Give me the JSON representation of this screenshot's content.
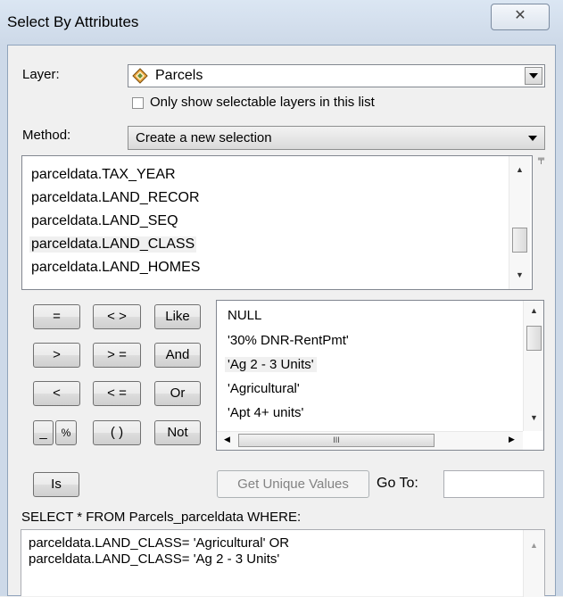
{
  "window": {
    "title": "Select By Attributes",
    "close_glyph": "✕"
  },
  "layer": {
    "label": "Layer:",
    "value": "Parcels",
    "icon": "layer-diamond-icon",
    "only_selectable_label": "Only show selectable layers in this list"
  },
  "method": {
    "label": "Method:",
    "value": "Create a new selection"
  },
  "fields": {
    "items": [
      "parceldata.TAX_YEAR",
      "parceldata.LAND_RECOR",
      "parceldata.LAND_SEQ",
      "parceldata.LAND_CLASS",
      "parceldata.LAND_HOMES"
    ],
    "selected": "parceldata.LAND_CLASS"
  },
  "operators": {
    "eq": "=",
    "neq": "< >",
    "like": "Like",
    "gt": ">",
    "gte": "> =",
    "and": "And",
    "lt": "<",
    "lte": "< =",
    "or": "Or",
    "underscore": "_",
    "percent": "%",
    "parens": "( )",
    "not": "Not",
    "is": "Is"
  },
  "values": {
    "items": [
      "NULL",
      "'30% DNR-RentPmt'",
      "'Ag 2 - 3 Units'",
      "'Agricultural'",
      "'Apt 4+ units'"
    ],
    "selected": "'Ag 2 - 3 Units'",
    "hscroll_grip": "III"
  },
  "unique": {
    "button": "Get Unique Values",
    "goto_label": "Go To:",
    "goto_value": ""
  },
  "query": {
    "header": "SELECT * FROM Parcels_parceldata WHERE:",
    "line1": "parceldata.LAND_CLASS= 'Agricultural' OR",
    "line2": "parceldata.LAND_CLASS= 'Ag 2 - 3 Units'"
  },
  "colors": {
    "frame": "#cdd9e8",
    "selection_bg": "#f0f0f0",
    "disabled_text": "#838383"
  }
}
